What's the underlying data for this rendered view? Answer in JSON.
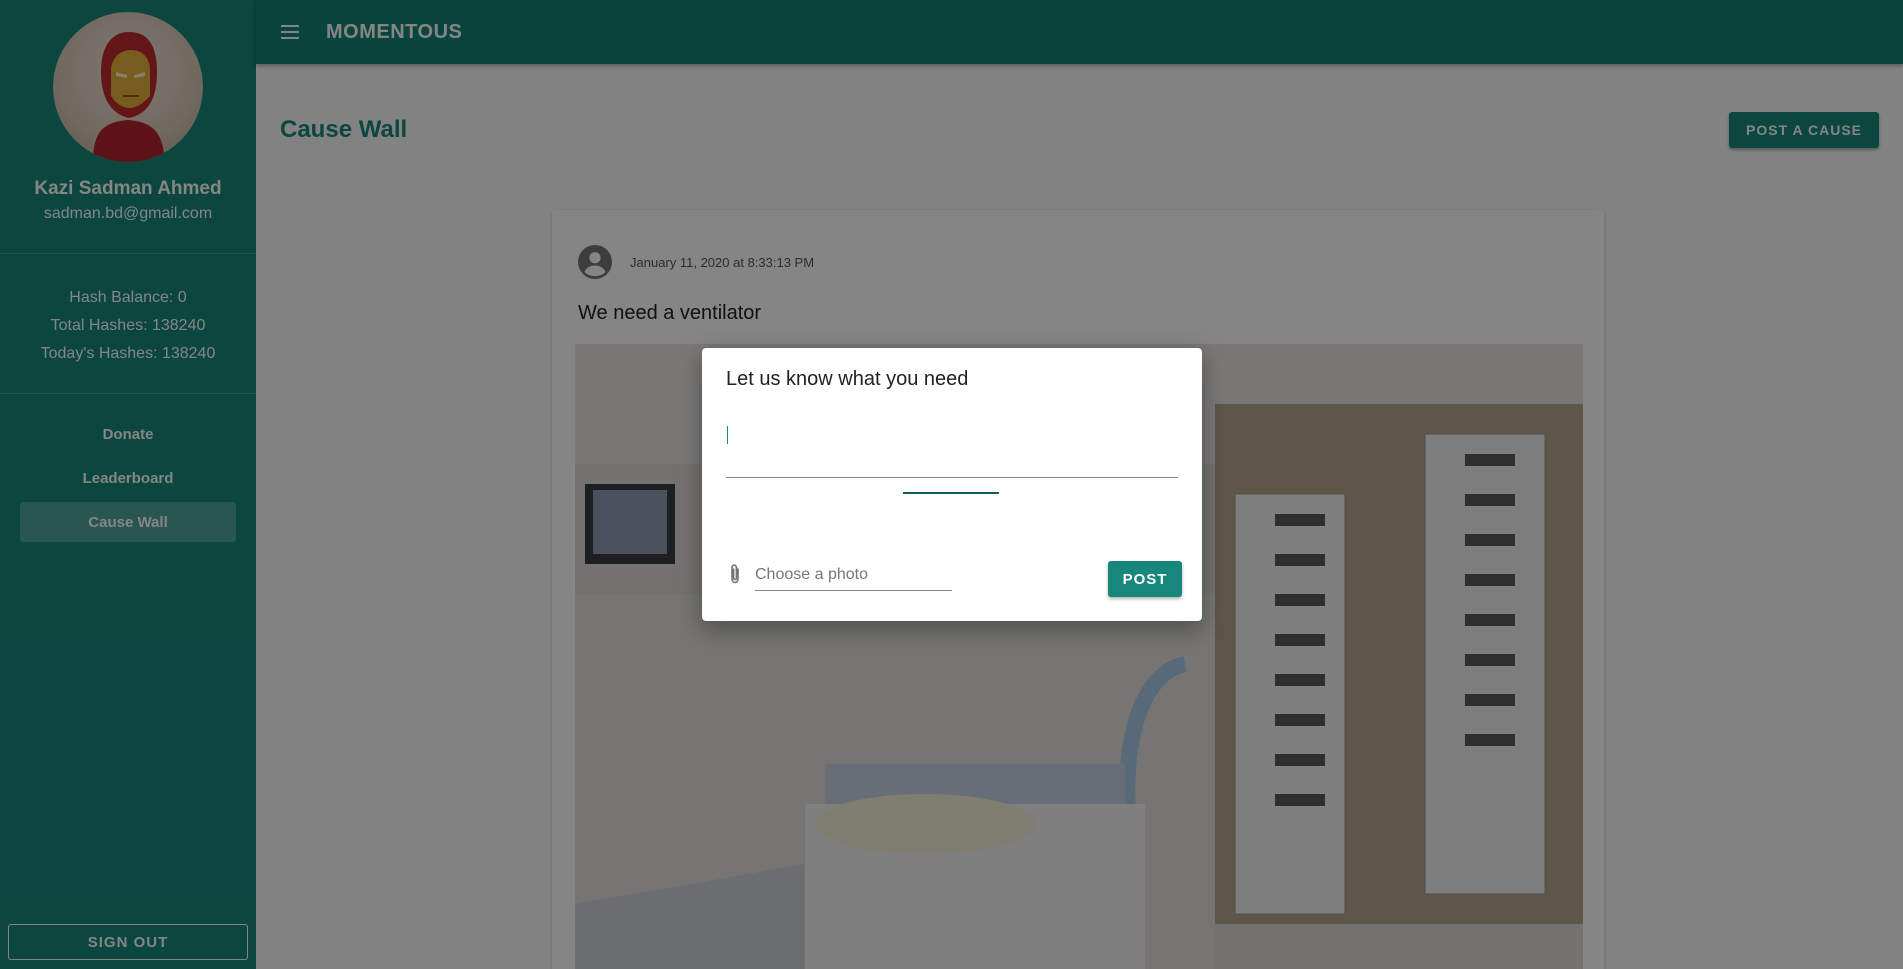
{
  "app": {
    "brand": "MOMENTOUS"
  },
  "user": {
    "name": "Kazi Sadman Ahmed",
    "email": "sadman.bd@gmail.com"
  },
  "stats": {
    "hash_balance": "Hash Balance: 0",
    "total_hashes": "Total Hashes: 138240",
    "todays_hashes": "Today's Hashes: 138240"
  },
  "nav": {
    "items": [
      {
        "label": "Donate",
        "active": false
      },
      {
        "label": "Leaderboard",
        "active": false
      },
      {
        "label": "Cause Wall",
        "active": true
      }
    ],
    "signout_label": "SIGN OUT"
  },
  "main": {
    "title": "Cause Wall",
    "post_cause_label": "POST A CAUSE"
  },
  "post": {
    "timestamp": "January 11, 2020 at 8:33:13 PM",
    "text": "We need a ventilator",
    "photo": "hospital-icu-photo"
  },
  "dialog": {
    "title": "Let us know what you need",
    "textarea_value": "",
    "file_placeholder": "Choose a photo",
    "post_label": "POST"
  },
  "colors": {
    "primary": "#16877a",
    "appbar": "#158576",
    "focus": "#0d5e55"
  }
}
